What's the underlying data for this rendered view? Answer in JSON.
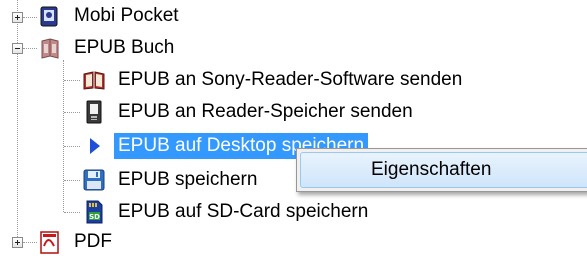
{
  "tree": {
    "items": [
      {
        "label": "Mobi Pocket",
        "icon": "mobi-book-icon",
        "expander": "plus"
      },
      {
        "label": "EPUB Buch",
        "icon": "epub-book-icon",
        "expander": "minus"
      },
      {
        "label": "EPUB an Sony-Reader-Software senden",
        "icon": "open-book-icon"
      },
      {
        "label": "EPUB an Reader-Speicher senden",
        "icon": "ebook-reader-icon"
      },
      {
        "label": "EPUB auf Desktop speichern",
        "icon": "play-arrow-icon",
        "selected": true
      },
      {
        "label": "EPUB speichern",
        "icon": "floppy-disk-icon"
      },
      {
        "label": "EPUB auf SD-Card speichern",
        "icon": "sd-card-icon"
      },
      {
        "label": "PDF",
        "icon": "pdf-document-icon",
        "expander": "plus"
      }
    ]
  },
  "context_menu": {
    "items": [
      {
        "label": "Eigenschaften",
        "highlighted": true
      }
    ]
  },
  "colors": {
    "selection": "#3399ff",
    "menu_background": "#f0f0f0",
    "menu_highlight": "#cfe5fb"
  }
}
